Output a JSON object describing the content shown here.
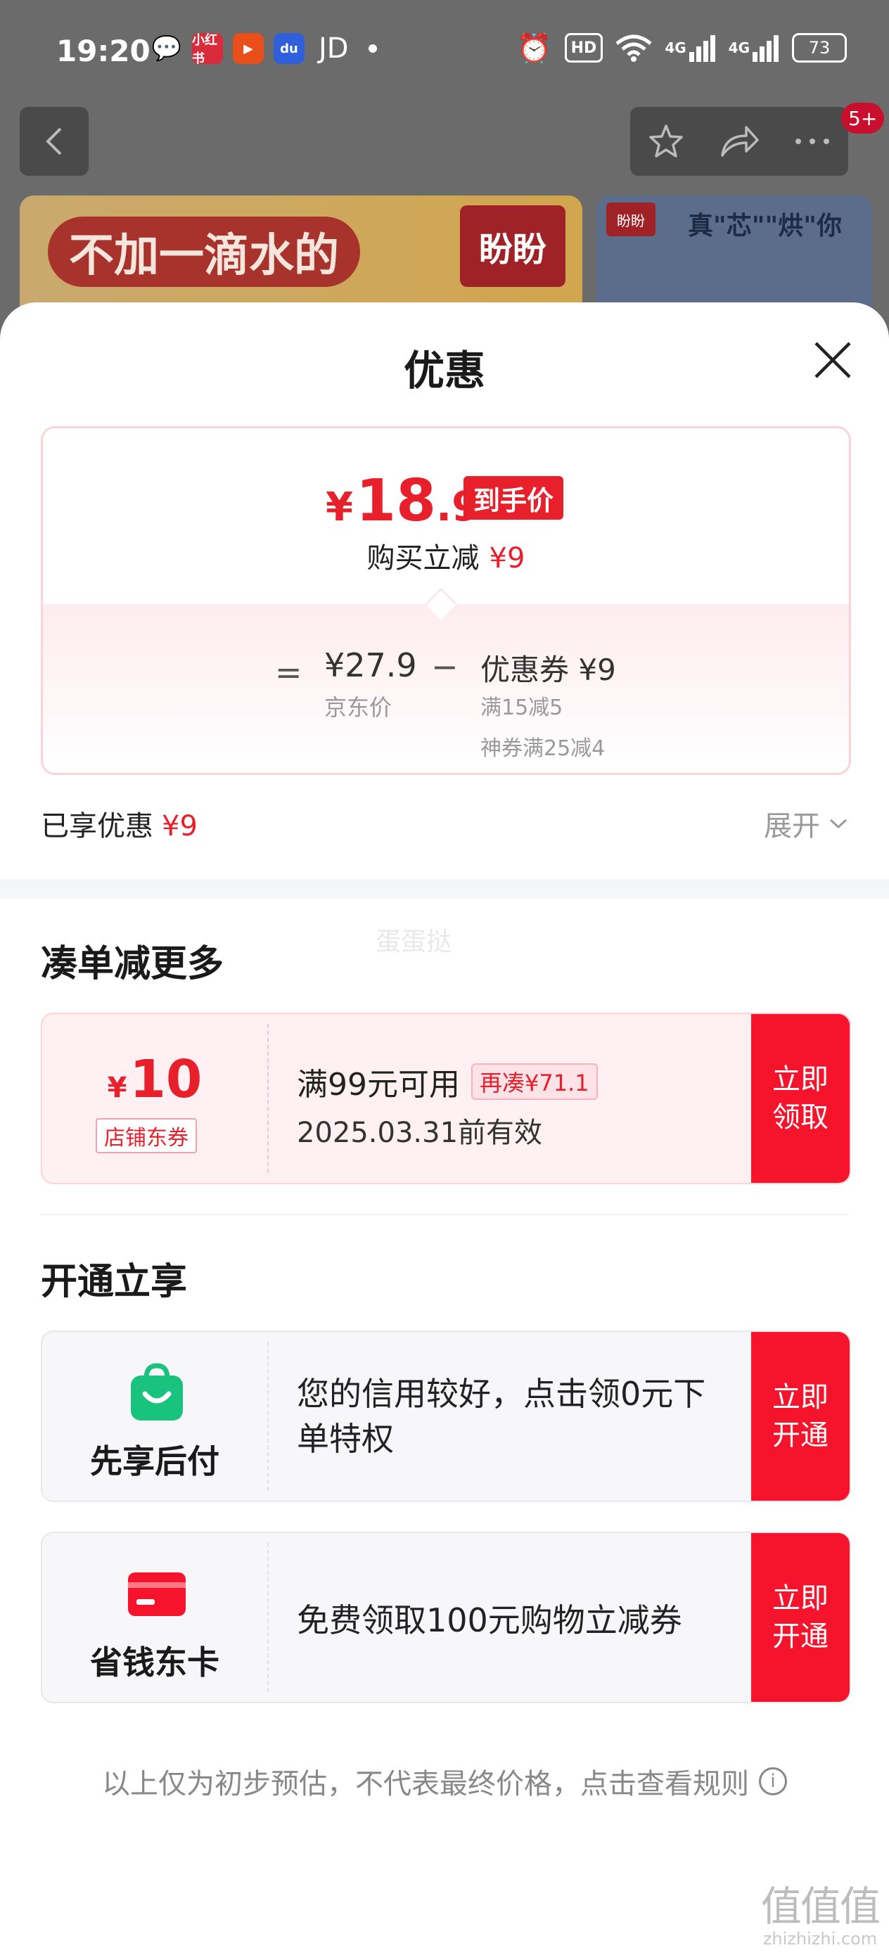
{
  "statusbar": {
    "time": "19:20",
    "apps": [
      "wechat",
      "小红书",
      "video-play",
      "baidu"
    ],
    "jd_text": "JD",
    "network_1": "4G",
    "network_2": "4G",
    "battery": "73"
  },
  "nav": {
    "badge": "5+"
  },
  "banner": {
    "main_text": "不加一滴水的",
    "brand_logo": "盼盼",
    "side_text": "真\"芯\"\"烘\"你"
  },
  "sheet": {
    "title": "优惠",
    "final_price": {
      "yen": "¥",
      "int": "18",
      "dec": ".9"
    },
    "final_tag": "到手价",
    "reduce_label": "购买立减",
    "reduce_value": "¥9",
    "eq": "=",
    "jd_price": "¥27.9",
    "jd_label": "京东价",
    "minus": "−",
    "coupon_total": "优惠券 ¥9",
    "coupon_detail_1": "满15减5",
    "coupon_detail_2": "神券满25减4",
    "enjoyed_label": "已享优惠",
    "enjoyed_value": "¥9",
    "expand_label": "展开",
    "watermark": "蛋蛋挞"
  },
  "section_more": {
    "title": "凑单减更多",
    "coupon": {
      "yen": "¥",
      "amount": "10",
      "tag": "店铺东券",
      "condition": "满99元可用",
      "more_tag": "再凑¥71.1",
      "expiry": "2025.03.31前有效",
      "button_line1": "立即",
      "button_line2": "领取"
    }
  },
  "section_open": {
    "title": "开通立享",
    "services": [
      {
        "name": "先享后付",
        "text": "您的信用较好，点击领0元下单特权",
        "button_line1": "立即",
        "button_line2": "开通",
        "icon_color": "#19c37d"
      },
      {
        "name": "省钱东卡",
        "text": "免费领取100元购物立减券",
        "button_line1": "立即",
        "button_line2": "开通",
        "icon_color": "#f5142b"
      }
    ]
  },
  "footer": {
    "note": "以上仅为初步预估，不代表最终价格，点击查看规则"
  },
  "corner_logo": {
    "mark": "值值值",
    "url": "zhizhizhi.com"
  },
  "colors": {
    "accent_red": "#e8202b",
    "button_red": "#f5142b",
    "green": "#19c37d"
  }
}
